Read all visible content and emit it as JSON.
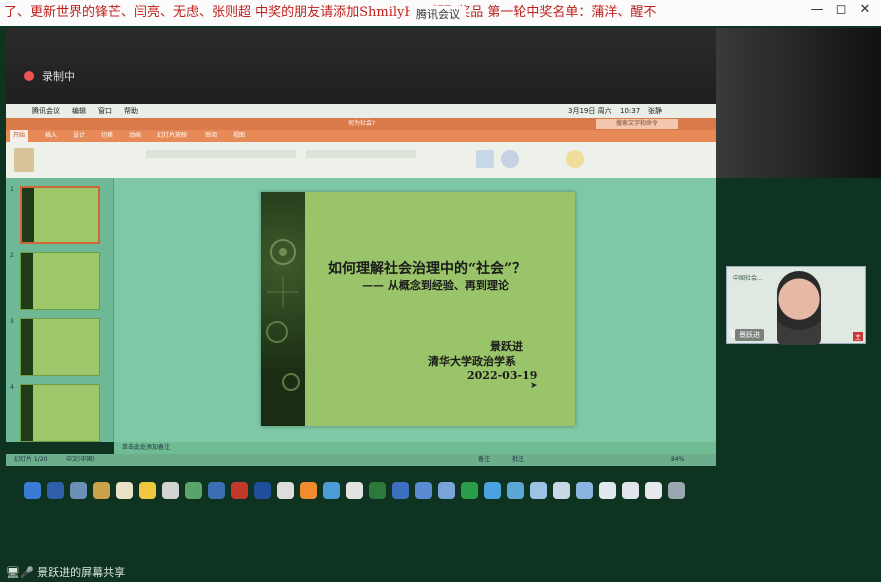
{
  "ticker": {
    "text": "了、更新世界的锋芒、闫亮、无虑、张则超  中奖的朋友请添加ShmilyHID领取奖品    第一轮中奖名单：蒲洋、醒不"
  },
  "window": {
    "title": "腾讯会议",
    "minimize": "—",
    "restore": "◻",
    "close": "✕"
  },
  "recording": {
    "label": "录制中",
    "dot_color": "#e55555"
  },
  "mac_menu": {
    "app": "腾讯会议",
    "items": [
      "编辑",
      "窗口",
      "帮助"
    ],
    "date": "3月19日 周六",
    "time": "10:37",
    "user": "张静"
  },
  "ppt": {
    "title": "何为社会?",
    "search": "搜索文字和命令",
    "tabs": [
      "开始",
      "插入",
      "设计",
      "切换",
      "动画",
      "幻灯片放映",
      "审阅",
      "视图"
    ],
    "active_tab": "开始",
    "notes": "单击此处添加备注",
    "status_left": "幻灯片 1/20",
    "status_lang": "中文(中国)",
    "status_notes": "备注",
    "status_comments": "批注",
    "zoom": "84%"
  },
  "thumbnails": [
    {
      "num": "1"
    },
    {
      "num": "2"
    },
    {
      "num": "3"
    },
    {
      "num": "4"
    }
  ],
  "slide": {
    "title": "如何理解社会治理中的“社会”？",
    "subtitle": "—— 从概念到经验、再到理论",
    "author": "景跃进",
    "dept": "清华大学政治学系",
    "date": "2022-03-19"
  },
  "video": {
    "logo_text": "中国社会…",
    "name": "景跃进",
    "badge": "主"
  },
  "share": {
    "label": "景跃进的屏幕共享"
  },
  "colors": {
    "ticker_text": "#c0201c",
    "ribbon": "#e88a58",
    "slide_bg": "#9ac46a",
    "overlay": "#7ec8a6"
  }
}
